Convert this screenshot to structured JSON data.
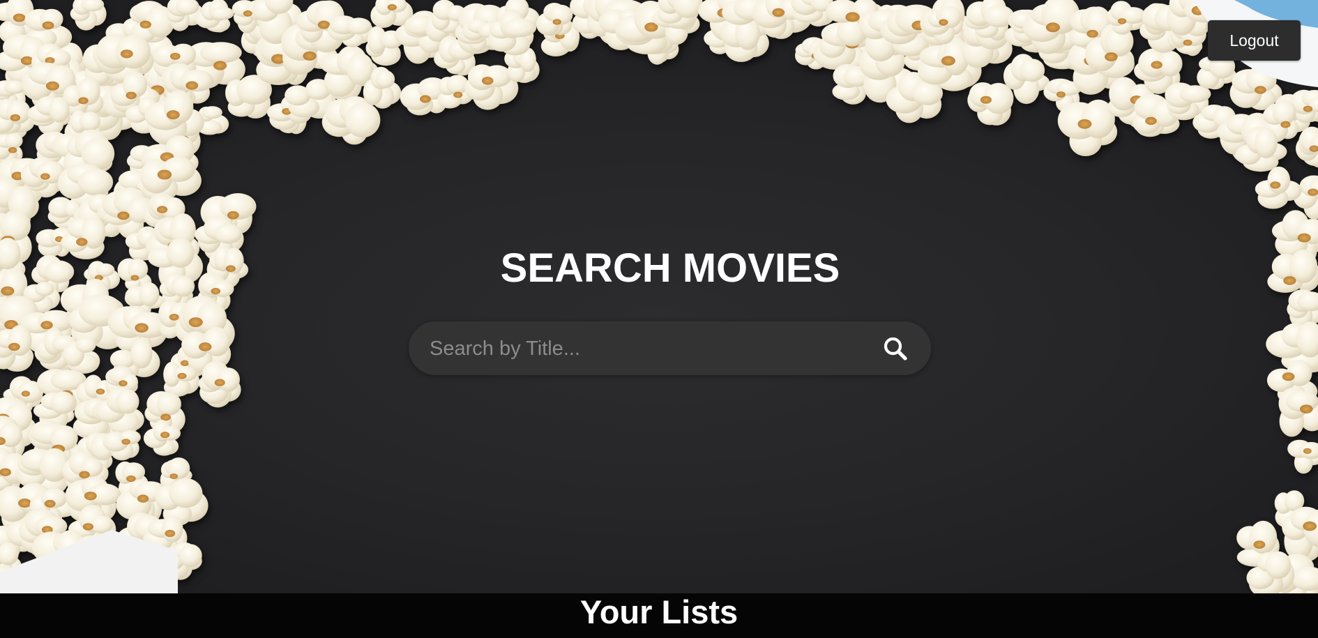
{
  "header": {
    "logout_label": "Logout"
  },
  "hero": {
    "title": "SEARCH MOVIES",
    "background_image": "popcorn-on-dark-background",
    "search": {
      "placeholder": "Search by Title...",
      "value": "",
      "icon": "search-icon"
    }
  },
  "lists": {
    "title": "Your Lists"
  },
  "colors": {
    "background": "#262628",
    "search_bar": "#333334",
    "button": "#2d2d2d",
    "text": "#ffffff",
    "footer_bar": "#050505"
  }
}
